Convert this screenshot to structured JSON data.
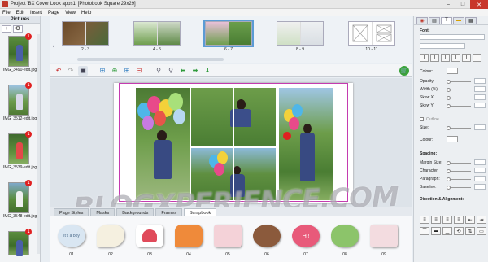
{
  "window": {
    "title": "Project 'BX Cover Look apps1' [Photobook Square 29x29]"
  },
  "menu": [
    "File",
    "Edit",
    "Insert",
    "Page",
    "View",
    "Help"
  ],
  "left_panel": {
    "header": "Pictures",
    "add_label": "+",
    "settings_label": "⚙",
    "pictures": [
      {
        "name": "IMG_3490-edit.jpg",
        "badge": "1"
      },
      {
        "name": "IMG_3512-edit.jpg",
        "badge": "1"
      },
      {
        "name": "IMG_3539-edit.jpg",
        "badge": "1"
      },
      {
        "name": "IMG_3548-edit.jpg",
        "badge": "1"
      },
      {
        "name": "",
        "badge": "1"
      }
    ]
  },
  "page_strip": {
    "spreads": [
      {
        "label": "2 - 3"
      },
      {
        "label": "4 - 5"
      },
      {
        "label": "6 - 7",
        "selected": true
      },
      {
        "label": "8 - 9"
      },
      {
        "label": "10 - 11"
      }
    ]
  },
  "tabs": [
    "Page Styles",
    "Masks",
    "Backgrounds",
    "Frames",
    "Scrapbook"
  ],
  "active_tab": "Scrapbook",
  "stickers": [
    {
      "label": "01",
      "text": "It's a boy",
      "color": "#d9e6f2"
    },
    {
      "label": "02",
      "text": "",
      "color": "#f5f0e0"
    },
    {
      "label": "03",
      "text": "",
      "color": "#e04a5a"
    },
    {
      "label": "04",
      "text": "",
      "color": "#ef8a3a"
    },
    {
      "label": "05",
      "text": "",
      "color": "#f4d2d8"
    },
    {
      "label": "06",
      "text": "",
      "color": "#8b5a3c"
    },
    {
      "label": "07",
      "text": "Hi!",
      "color": "#e85a7a"
    },
    {
      "label": "08",
      "text": "",
      "color": "#8cc46a"
    },
    {
      "label": "09",
      "text": "",
      "color": "#f3dce0"
    }
  ],
  "watermark": "BLOGXPERIENCE.COM",
  "right_panel": {
    "font_label": "Font:",
    "colour_label": "Colour:",
    "opacity_label": "Opacity:",
    "width_label": "Width (%):",
    "skewx_label": "Skew X:",
    "skewy_label": "Skew Y:",
    "outline_label": "Outline",
    "size_label": "Size:",
    "colour2_label": "Colour:",
    "spacing_label": "Spacing:",
    "margin_label": "Margin Size:",
    "character_label": "Character:",
    "paragraph_label": "Paragraph:",
    "baseline_label": "Baseline:",
    "direction_label": "Direction & Alignment:"
  },
  "colors": {
    "accent": "#5b9bd5",
    "selection": "#c43bb0",
    "close": "#c8362b"
  }
}
